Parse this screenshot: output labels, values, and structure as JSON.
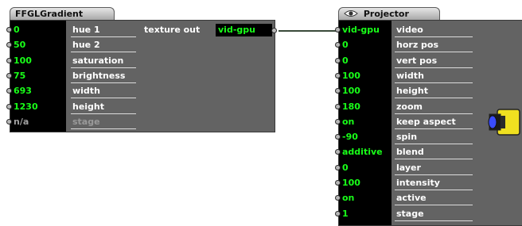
{
  "gradient": {
    "title": "FFGLGradient",
    "rows": [
      {
        "value": "0",
        "label": "hue 1",
        "dim": false
      },
      {
        "value": "50",
        "label": "hue 2",
        "dim": false
      },
      {
        "value": "100",
        "label": "saturation",
        "dim": false
      },
      {
        "value": "75",
        "label": "brightness",
        "dim": false
      },
      {
        "value": "693",
        "label": "width",
        "dim": false
      },
      {
        "value": "1230",
        "label": "height",
        "dim": false
      },
      {
        "value": "n/a",
        "label": "stage",
        "dim": true
      }
    ],
    "output": {
      "label": "texture out",
      "value": "vid-gpu"
    }
  },
  "projector": {
    "title": "Projector",
    "eye_icon": "eye-icon",
    "thumbnail_icon": "projector-icon",
    "colors": {
      "thumb_body": "#f0e020",
      "thumb_lens": "#3a4cff"
    },
    "rows": [
      {
        "value": "vid-gpu",
        "label": "video"
      },
      {
        "value": "0",
        "label": "horz pos"
      },
      {
        "value": "0",
        "label": "vert pos"
      },
      {
        "value": "100",
        "label": "width"
      },
      {
        "value": "100",
        "label": "height"
      },
      {
        "value": "180",
        "label": "zoom"
      },
      {
        "value": "on",
        "label": "keep aspect"
      },
      {
        "value": "-90",
        "label": "spin"
      },
      {
        "value": "additive",
        "label": "blend"
      },
      {
        "value": "0",
        "label": "layer"
      },
      {
        "value": "100",
        "label": "intensity"
      },
      {
        "value": "on",
        "label": "active"
      },
      {
        "value": "1",
        "label": "stage"
      }
    ]
  },
  "colors": {
    "value_text": "#19ff19",
    "box_bg": "#636363",
    "cable": "#3a4a3a"
  }
}
